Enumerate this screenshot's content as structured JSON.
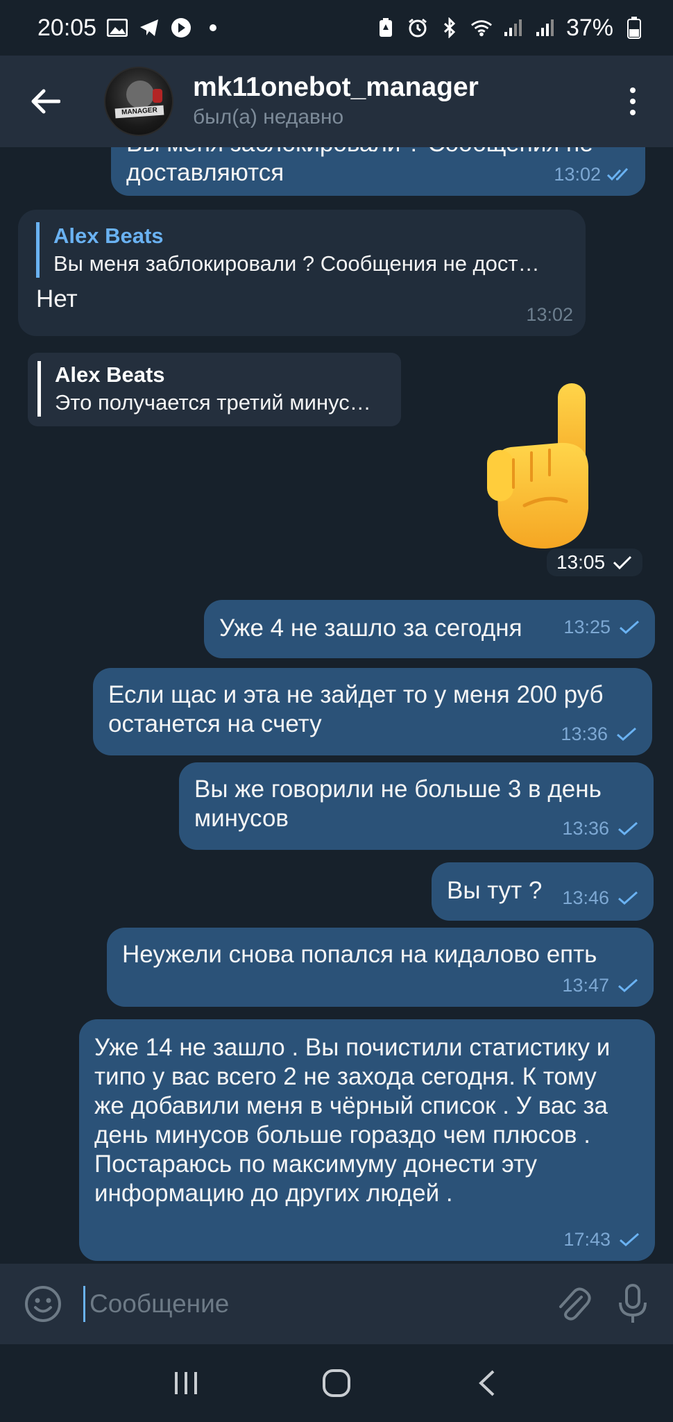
{
  "status_bar": {
    "time": "20:05",
    "battery": "37%",
    "icons_left": [
      "image-icon",
      "telegram-icon",
      "play-circle-icon",
      "dot-icon"
    ],
    "icons_right": [
      "battery-saver-icon",
      "alarm-icon",
      "bluetooth-icon",
      "wifi-icon",
      "signal-icon",
      "signal-icon",
      "battery-icon"
    ]
  },
  "header": {
    "title": "mk11onebot_manager",
    "subtitle": "был(а) недавно",
    "avatar_label": "MANAGER"
  },
  "messages": {
    "m0": {
      "text": "доставляются",
      "cut_text": "Вы меня заблокировали ? Сообщения не",
      "time": "13:02",
      "status": "read"
    },
    "m1": {
      "reply_name": "Alex Beats",
      "reply_text": "Вы меня  заблокировали ? Сообщения не дост…",
      "text": "Нет",
      "time": "13:02"
    },
    "m2": {
      "reply_name": "Alex Beats",
      "reply_text": "Это получается третий минус…",
      "sticker": "☝️",
      "time": "13:05",
      "status": "sent"
    },
    "m3": {
      "text": "Уже 4 не зашло за сегодня",
      "time": "13:25",
      "status": "sent"
    },
    "m4": {
      "text": "Если щас и эта не зайдет то у меня 200 руб останется на счету",
      "time": "13:36",
      "status": "sent"
    },
    "m5": {
      "text": "Вы же говорили не больше 3 в день минусов",
      "time": "13:36",
      "status": "sent"
    },
    "m6": {
      "text": "Вы тут ?",
      "time": "13:46",
      "status": "sent"
    },
    "m7": {
      "text": "Неужели снова попался на кидалово епть",
      "time": "13:47",
      "status": "sent"
    },
    "m8": {
      "text": "Уже 14 не зашло . Вы почистили статистику и типо у вас всего 2 не захода сегодня.  К тому же добавили меня в чёрный список . У вас за день минусов больше гораздо чем плюсов . Постараюсь по максимуму донести эту информацию до других людей .",
      "time": "17:43",
      "status": "sent"
    }
  },
  "input": {
    "placeholder": "Сообщение"
  },
  "colors": {
    "background": "#17212b",
    "header": "#242f3d",
    "outgoing": "#2b5278",
    "incoming": "#212d3b",
    "accent": "#6ab2f2"
  }
}
